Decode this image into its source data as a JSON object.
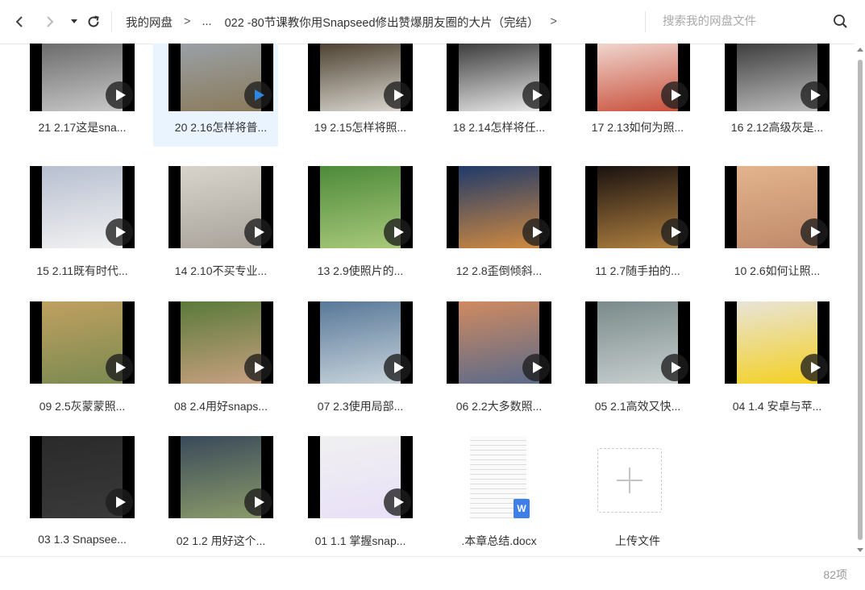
{
  "toolbar": {
    "back_icon": "chevron-left-icon",
    "forward_icon": "chevron-right-icon",
    "history_icon": "caret-down-icon",
    "refresh_icon": "refresh-icon"
  },
  "breadcrumb": {
    "root": "我的网盘",
    "separator": ">",
    "ellipsis": "...",
    "current": "022 -80节课教你用Snapseed修出赞爆朋友圈的大片（完结）",
    "trailing_separator": ">"
  },
  "search": {
    "placeholder": "搜索我的网盘文件",
    "icon": "search-icon"
  },
  "files": [
    {
      "label": "21 2.17这是sna...",
      "type": "video",
      "row": 0,
      "col": 0
    },
    {
      "label": "20 2.16怎样将普...",
      "type": "video",
      "row": 0,
      "col": 1,
      "selected": true
    },
    {
      "label": "19 2.15怎样将照...",
      "type": "video",
      "row": 0,
      "col": 2
    },
    {
      "label": "18 2.14怎样将任...",
      "type": "video",
      "row": 0,
      "col": 3
    },
    {
      "label": "17 2.13如何为照...",
      "type": "video",
      "row": 0,
      "col": 4
    },
    {
      "label": "16 2.12高级灰是...",
      "type": "video",
      "row": 0,
      "col": 5
    },
    {
      "label": "15 2.11既有时代...",
      "type": "video",
      "row": 1,
      "col": 0
    },
    {
      "label": "14 2.10不买专业...",
      "type": "video",
      "row": 1,
      "col": 1
    },
    {
      "label": "13 2.9使照片的...",
      "type": "video",
      "row": 1,
      "col": 2
    },
    {
      "label": "12 2.8歪倒倾斜...",
      "type": "video",
      "row": 1,
      "col": 3
    },
    {
      "label": "11 2.7随手拍的...",
      "type": "video",
      "row": 1,
      "col": 4
    },
    {
      "label": "10 2.6如何让照...",
      "type": "video",
      "row": 1,
      "col": 5
    },
    {
      "label": "09 2.5灰蒙蒙照...",
      "type": "video",
      "row": 2,
      "col": 0
    },
    {
      "label": "08 2.4用好snaps...",
      "type": "video",
      "row": 2,
      "col": 1
    },
    {
      "label": "07 2.3使用局部...",
      "type": "video",
      "row": 2,
      "col": 2
    },
    {
      "label": "06 2.2大多数照...",
      "type": "video",
      "row": 2,
      "col": 3
    },
    {
      "label": "05 2.1高效又快...",
      "type": "video",
      "row": 2,
      "col": 4
    },
    {
      "label": "04 1.4 安卓与苹...",
      "type": "video",
      "row": 2,
      "col": 5
    },
    {
      "label": "03 1.3 Snapsee...",
      "type": "video",
      "row": 3,
      "col": 0
    },
    {
      "label": "02 1.2 用好这个...",
      "type": "video",
      "row": 3,
      "col": 1
    },
    {
      "label": "01 1.1 掌握snap...",
      "type": "video",
      "row": 3,
      "col": 2
    },
    {
      "label": ".本章总结.docx",
      "type": "docx",
      "row": 3,
      "col": 3,
      "badge": "W"
    },
    {
      "label": "上传文件",
      "type": "upload",
      "row": 3,
      "col": 4
    }
  ],
  "thumb_colors": [
    [
      "#6a6a6a",
      "#c8c8c8"
    ],
    [
      "#9aa1a8",
      "#8a7a5a"
    ],
    [
      "#4b3f2e",
      "#d9d6cf"
    ],
    [
      "#3a3a3a",
      "#e8e8e8"
    ],
    [
      "#f0d8d0",
      "#c9503c"
    ],
    [
      "#3c3c3c",
      "#bdbdbd"
    ],
    [
      "#b7bfd0",
      "#f2f2f2"
    ],
    [
      "#d8d4cc",
      "#a9a39a"
    ],
    [
      "#4c8a3a",
      "#a9c97a"
    ],
    [
      "#203a6a",
      "#d08a40"
    ],
    [
      "#1a1210",
      "#b08040"
    ],
    [
      "#e2b48c",
      "#c08a6a"
    ],
    [
      "#c0a060",
      "#7a8a50"
    ],
    [
      "#5a7a3a",
      "#c8a080"
    ],
    [
      "#587898",
      "#c8d4dc"
    ],
    [
      "#d08a60",
      "#5a6a8a"
    ],
    [
      "#7a8a8a",
      "#c8cfcf"
    ],
    [
      "#e8e4d8",
      "#f4d020"
    ],
    [
      "#2a2a2a",
      "#3a3a3a"
    ],
    [
      "#3a4a5a",
      "#8a9a6a"
    ],
    [
      "#f0f0f0",
      "#e8e0f8"
    ]
  ],
  "accent_color": "#2e86de",
  "status": {
    "count": "82项"
  }
}
